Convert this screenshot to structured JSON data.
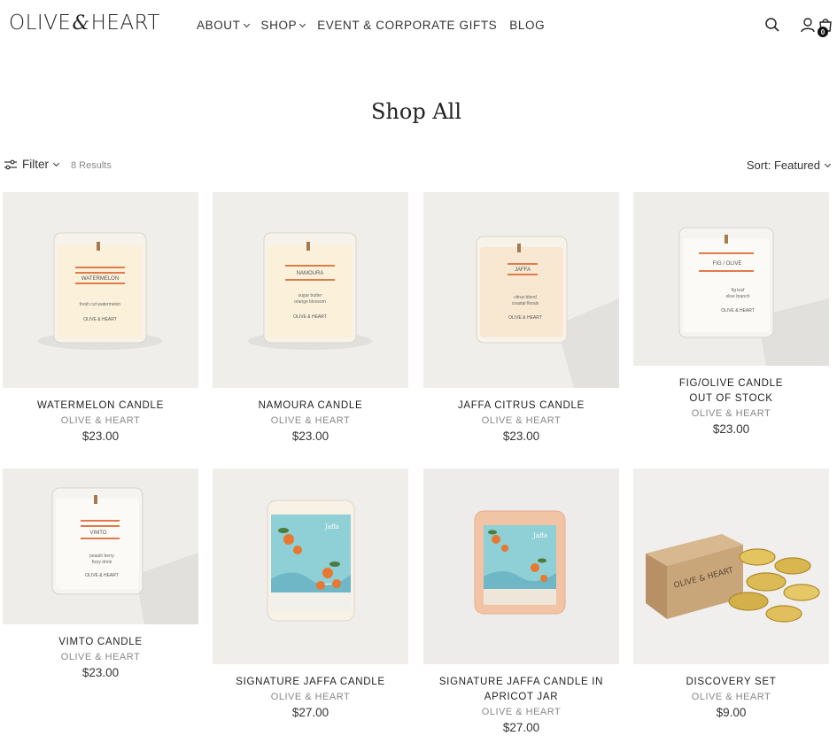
{
  "header": {
    "logo_left": "OLIVE",
    "logo_amp": "&",
    "logo_right": "HEART",
    "nav": [
      {
        "label": "ABOUT"
      },
      {
        "label": "SHOP"
      },
      {
        "label": "EVENT & CORPORATE GIFTS"
      },
      {
        "label": "BLOG"
      }
    ],
    "cart_count": "0",
    "icons": [
      "search-icon",
      "account-icon",
      "cart-icon"
    ]
  },
  "page": {
    "title": "Shop All"
  },
  "toolbar": {
    "filter_label": "Filter",
    "results": "8 Results",
    "sort_label": "Sort: Featured"
  },
  "products": [
    {
      "name": "WATERMELON CANDLE",
      "brand": "OLIVE & HEART",
      "price": "$23.00"
    },
    {
      "name": "NAMOURA CANDLE",
      "brand": "OLIVE & HEART",
      "price": "$23.00"
    },
    {
      "name": "JAFFA CITRUS CANDLE",
      "brand": "OLIVE & HEART",
      "price": "$23.00"
    },
    {
      "name": "FIG/OLIVE CANDLE",
      "sub": "OUT OF STOCK",
      "brand": "OLIVE & HEART",
      "price": "$23.00"
    },
    {
      "name": "VIMTO CANDLE",
      "brand": "OLIVE & HEART",
      "price": "$23.00"
    },
    {
      "name": "SIGNATURE JAFFA CANDLE",
      "brand": "OLIVE & HEART",
      "price": "$27.00"
    },
    {
      "name": "SIGNATURE JAFFA CANDLE IN APRICOT JAR",
      "brand": "OLIVE & HEART",
      "price": "$27.00"
    },
    {
      "name": "DISCOVERY SET",
      "brand": "OLIVE & HEART",
      "price": "$9.00"
    }
  ],
  "candle_labels": [
    {
      "title": "WATERMELON",
      "line1": "fresh cut watermelon",
      "line2": "",
      "maker": "OLIVE & HEART"
    },
    {
      "title": "NAMOURA",
      "line1": "sugar butter",
      "line2": "orange blossom",
      "maker": "OLIVE & HEART"
    },
    {
      "title": "JAFFA",
      "line1": "citrus blend",
      "line2": "coastal florals",
      "maker": "OLIVE & HEART"
    },
    {
      "title": "FIG / OLIVE",
      "line1": "fig leaf",
      "line2": "olive branch",
      "maker": "OLIVE & HEART"
    },
    {
      "title": "VIMTO",
      "line1": "peaulir berry",
      "line2": "fizzy drink",
      "maker": "OLIVE & HEART"
    }
  ],
  "jar_labels": [
    "Jaffa",
    "Jaffa"
  ],
  "box_label": "OLIVE & HEART",
  "colors": {
    "accent_orange": "#e07a4a",
    "jar_blue": "#8fcfd6",
    "apricot": "#f2c4a6",
    "tin_gold": "#d4b04a",
    "kraft": "#c9a67a"
  }
}
